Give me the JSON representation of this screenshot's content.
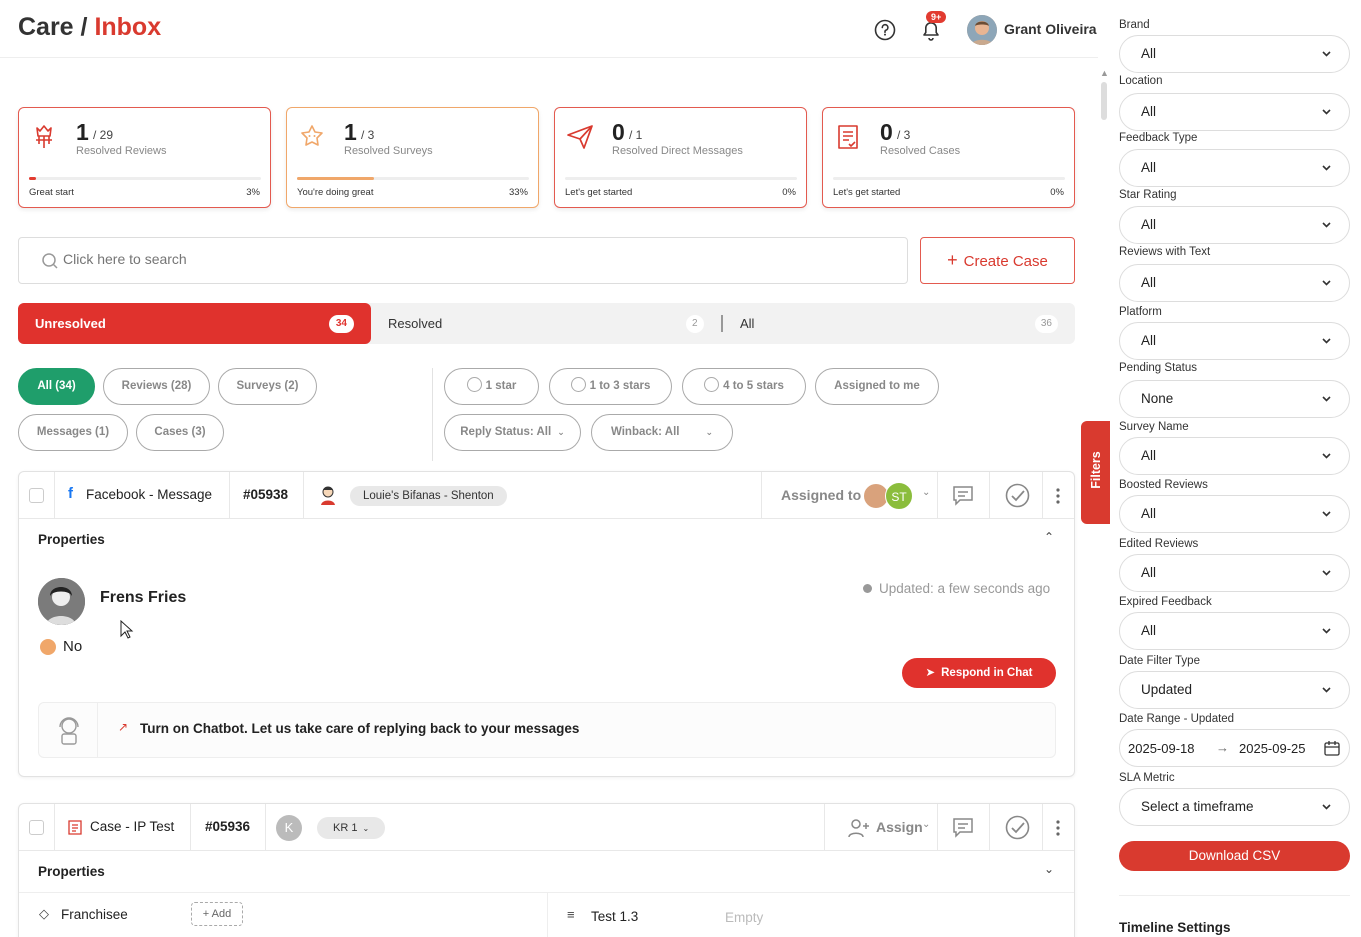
{
  "header": {
    "title_prefix": "Care /",
    "title_accent": "Inbox",
    "notification_badge": "9+",
    "user_name": "Grant Oliveira"
  },
  "stats": [
    {
      "count": "1",
      "total": "/ 29",
      "label": "Resolved Reviews",
      "message": "Great start",
      "percent": "3%",
      "progress": 0.03,
      "icon": "review-hands-icon"
    },
    {
      "count": "1",
      "total": "/ 3",
      "label": "Resolved Surveys",
      "message": "You're doing great",
      "percent": "33%",
      "progress": 0.33,
      "icon": "survey-star-icon"
    },
    {
      "count": "0",
      "total": "/ 1",
      "label": "Resolved Direct Messages",
      "message": "Let's get started",
      "percent": "0%",
      "progress": 0,
      "icon": "send-icon"
    },
    {
      "count": "0",
      "total": "/ 3",
      "label": "Resolved Cases",
      "message": "Let's get started",
      "percent": "0%",
      "progress": 0,
      "icon": "case-doc-icon"
    }
  ],
  "search": {
    "placeholder": "Click here to search"
  },
  "create_case_label": "Create Case",
  "tabs": {
    "unresolved": {
      "label": "Unresolved",
      "count": "34"
    },
    "resolved": {
      "label": "Resolved",
      "count": "2"
    },
    "all": {
      "label": "All",
      "count": "36"
    }
  },
  "type_chips": [
    "All (34)",
    "Reviews (28)",
    "Surveys (2)",
    "Messages (1)",
    "Cases (3)"
  ],
  "rating_chips": [
    "1 star",
    "1 to 3 stars",
    "4 to 5 stars",
    "Assigned to me"
  ],
  "dropdown_chips": [
    "Reply Status: All",
    "Winback: All"
  ],
  "cards": [
    {
      "source": "Facebook - Message",
      "id": "#05938",
      "location": "Louie's Bifanas - Shenton",
      "assigned_label": "Assigned to",
      "assignee_initials": "ST",
      "section_title": "Properties",
      "customer_name": "Frens Fries",
      "updated": "Updated: a few seconds ago",
      "message_text": "No",
      "respond_label": "Respond in Chat",
      "chatbot_text": "Turn on Chatbot. Let us take care of replying back to your messages"
    },
    {
      "source": "Case - IP Test",
      "id": "#05936",
      "avatar_initial": "K",
      "tag": "KR 1",
      "assign_label": "Assign",
      "section_title": "Properties",
      "field_label": "Franchisee",
      "add_label": "+ Add",
      "field2_label": "Test 1.3",
      "field2_value": "Empty"
    }
  ],
  "sidebar": {
    "filters": [
      {
        "label": "Brand",
        "value": "All"
      },
      {
        "label": "Location",
        "value": "All"
      },
      {
        "label": "Feedback Type",
        "value": "All"
      },
      {
        "label": "Star Rating",
        "value": "All"
      },
      {
        "label": "Reviews with Text",
        "value": "All"
      },
      {
        "label": "Platform",
        "value": "All"
      },
      {
        "label": "Pending Status",
        "value": "None"
      },
      {
        "label": "Survey Name",
        "value": "All"
      },
      {
        "label": "Boosted Reviews",
        "value": "All"
      },
      {
        "label": "Edited Reviews",
        "value": "All"
      },
      {
        "label": "Expired Feedback",
        "value": "All"
      },
      {
        "label": "Date Filter Type",
        "value": "Updated"
      }
    ],
    "date_range_label": "Date Range - Updated",
    "date_from": "2025-09-18",
    "date_to": "2025-09-25",
    "sla_label": "SLA Metric",
    "sla_placeholder": "Select a timeframe",
    "download_label": "Download CSV",
    "timeline_label": "Timeline Settings",
    "filters_tab_label": "Filters"
  },
  "colors": {
    "accent": "#d93a2f",
    "active_chip": "#1f9e6b",
    "orange": "#f0a76a"
  }
}
